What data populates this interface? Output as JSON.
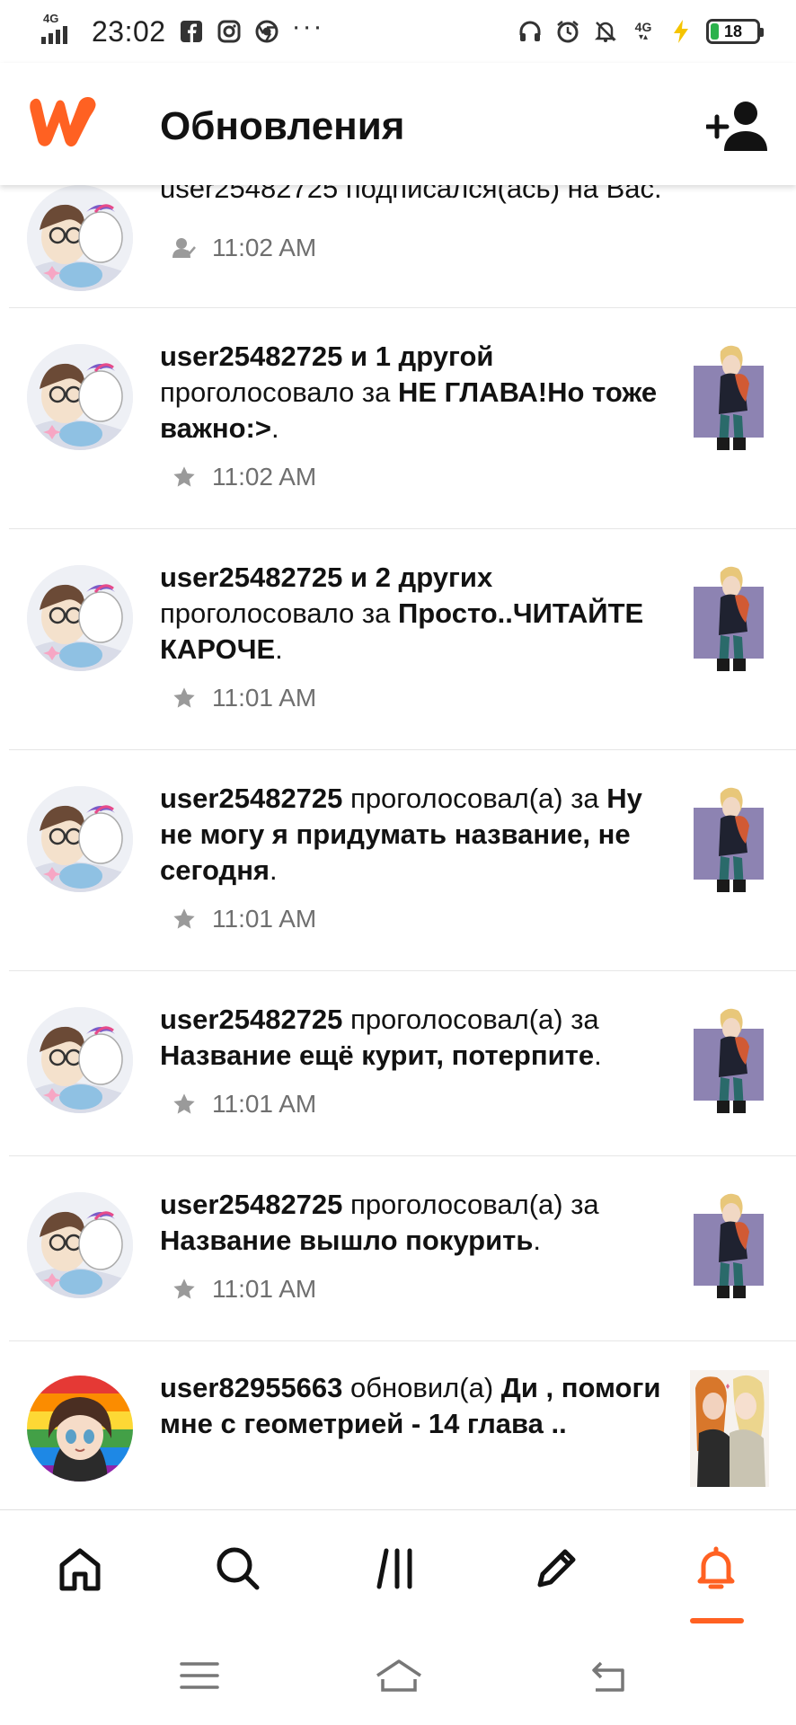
{
  "status_bar": {
    "network_label": "4G",
    "time": "23:02",
    "more": "···",
    "network_label_right": "4G",
    "battery": "18",
    "battery_level": 0.18,
    "battery_color": "#2bb24c"
  },
  "header": {
    "title": "Обновления",
    "brand_color": "#ff6122"
  },
  "feed": {
    "partial_top": {
      "text": "user25482725 подписался(ась) на Вас.",
      "time": "11:02 AM",
      "icon": "follow-icon"
    },
    "items": [
      {
        "parts": [
          {
            "text": "user25482725 и 1 другой",
            "bold": true
          },
          {
            "text": " проголосовало за ",
            "bold": false
          },
          {
            "text": "НЕ ГЛАВА!Но тоже важно:>",
            "bold": true
          },
          {
            "text": ".",
            "bold": false
          }
        ],
        "time": "11:02 AM",
        "icon": "star-icon"
      },
      {
        "parts": [
          {
            "text": "user25482725 и 2 других",
            "bold": true
          },
          {
            "text": " проголосовало за ",
            "bold": false
          },
          {
            "text": "Просто..ЧИТАЙТЕ КАРОЧЕ",
            "bold": true
          },
          {
            "text": ".",
            "bold": false
          }
        ],
        "time": "11:01 AM",
        "icon": "star-icon"
      },
      {
        "parts": [
          {
            "text": "user25482725",
            "bold": true
          },
          {
            "text": " проголосовал(а) за ",
            "bold": false
          },
          {
            "text": "Ну не могу я придумать название, не сегодня",
            "bold": true
          },
          {
            "text": ".",
            "bold": false
          }
        ],
        "time": "11:01 AM",
        "icon": "star-icon"
      },
      {
        "parts": [
          {
            "text": "user25482725",
            "bold": true
          },
          {
            "text": " проголосовал(а) за ",
            "bold": false
          },
          {
            "text": "Название ещё курит, потерпите",
            "bold": true
          },
          {
            "text": ".",
            "bold": false
          }
        ],
        "time": "11:01 AM",
        "icon": "star-icon"
      },
      {
        "parts": [
          {
            "text": "user25482725",
            "bold": true
          },
          {
            "text": " проголосовал(а) за ",
            "bold": false
          },
          {
            "text": "Название вышло покурить",
            "bold": true
          },
          {
            "text": ".",
            "bold": false
          }
        ],
        "time": "11:01 AM",
        "icon": "star-icon"
      },
      {
        "parts": [
          {
            "text": "user82955663",
            "bold": true
          },
          {
            "text": " обновил(а) ",
            "bold": false
          },
          {
            "text": "Ди , помоги мне с геометрией - 14 глава ..",
            "bold": true
          }
        ],
        "time": "",
        "icon": ""
      }
    ]
  },
  "bottom_nav": {
    "items": [
      "home-icon",
      "search-icon",
      "library-icon",
      "write-icon",
      "notifications-bell-icon"
    ],
    "active": "notifications-bell-icon",
    "active_color": "#ff6122"
  },
  "system_nav": {
    "items": [
      "menu-icon",
      "home-outline-icon",
      "back-icon"
    ]
  }
}
